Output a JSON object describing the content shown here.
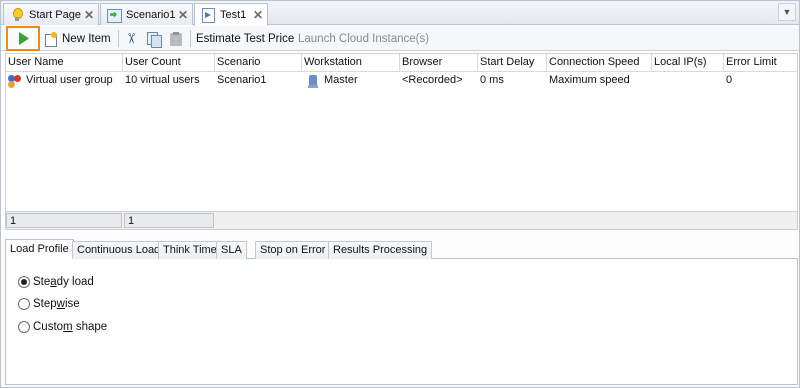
{
  "doc_tabs": [
    {
      "label": "Start Page",
      "icon": "lightbulb-icon",
      "active": false
    },
    {
      "label": "Scenario1",
      "icon": "scenario-icon",
      "active": false
    },
    {
      "label": "Test1",
      "icon": "test-icon",
      "active": true
    }
  ],
  "toolbar": {
    "run_icon": "play-icon",
    "new_item": "New Item",
    "estimate": "Estimate Test Price",
    "launch": "Launch Cloud Instance(s)"
  },
  "grid": {
    "columns": [
      "User Name",
      "User Count",
      "Scenario",
      "Workstation",
      "Browser",
      "Start Delay",
      "Connection Speed",
      "Local IP(s)",
      "Error Limit"
    ],
    "rows": [
      {
        "user_name": "Virtual user group",
        "user_count": "10 virtual users",
        "scenario": "Scenario1",
        "workstation": "Master",
        "browser": "<Recorded>",
        "start_delay": "0 ms",
        "connection_speed": "Maximum speed",
        "local_ip": "",
        "error_limit": "0"
      }
    ],
    "footer": [
      "1",
      "1"
    ]
  },
  "bottom_tabs": [
    "Load Profile",
    "Continuous Load",
    "Think Time",
    "SLA",
    "Stop on Error",
    "Results Processing"
  ],
  "load_profile": {
    "options": [
      {
        "pre": "Ste",
        "key": "a",
        "post": "dy load",
        "selected": true
      },
      {
        "pre": "Step",
        "key": "w",
        "post": "ise",
        "selected": false
      },
      {
        "pre": "Custo",
        "key": "m",
        "post": " shape",
        "selected": false
      }
    ]
  },
  "colors": {
    "highlight": "#ef8a1a",
    "play": "#3f9d3a",
    "border": "#b9c3cf"
  }
}
